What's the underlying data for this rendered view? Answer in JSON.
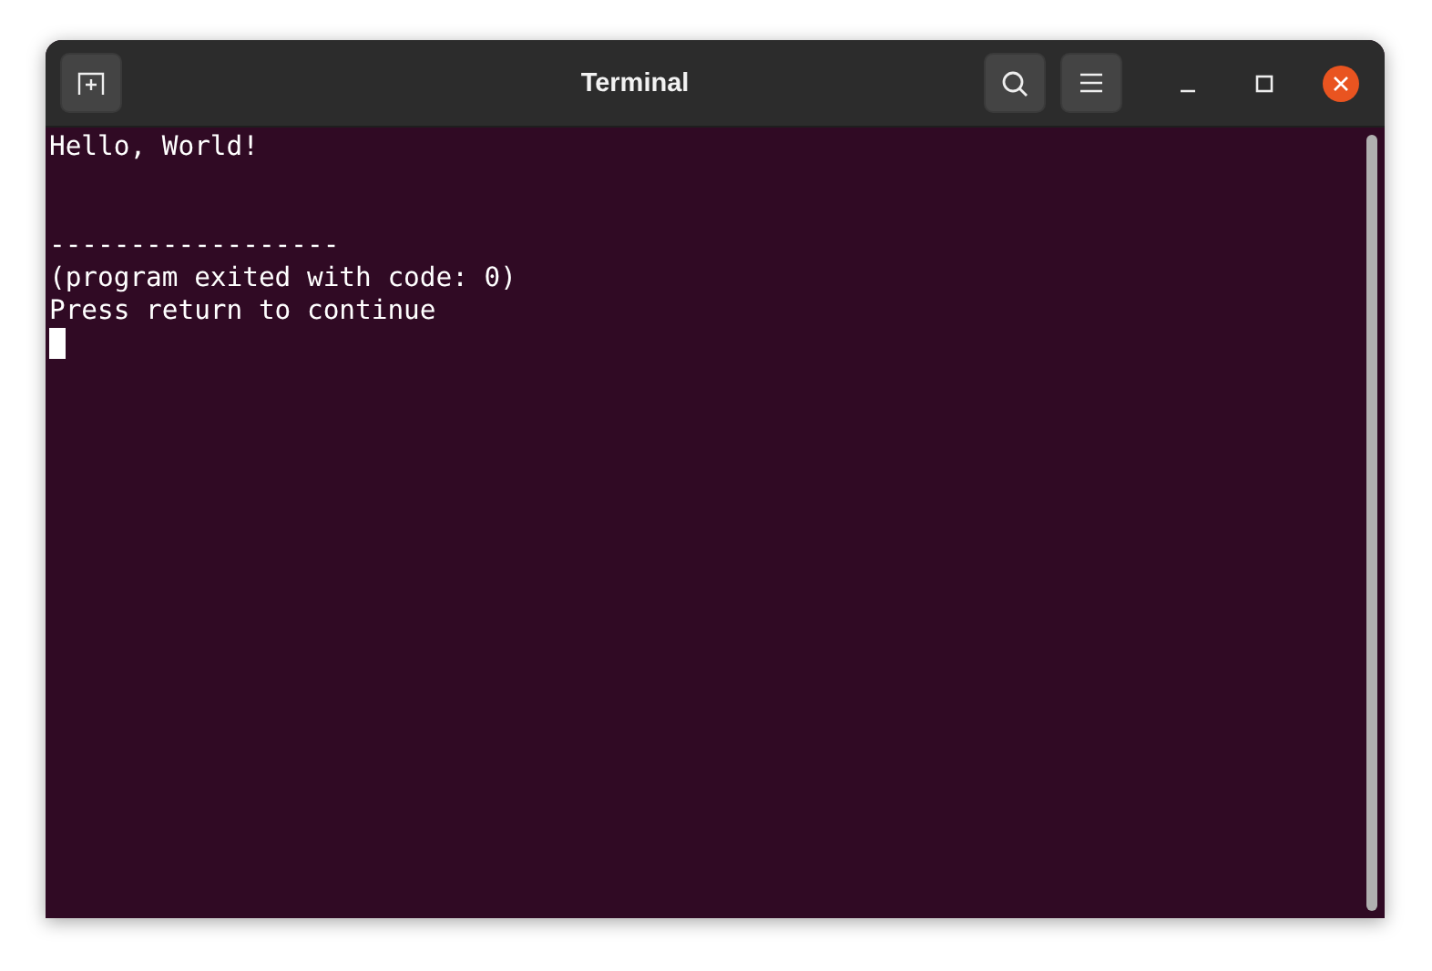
{
  "window": {
    "title": "Terminal"
  },
  "terminal": {
    "lines": [
      {
        "kind": "text",
        "text": "Hello, World!"
      },
      {
        "kind": "blank"
      },
      {
        "kind": "blank"
      },
      {
        "kind": "text",
        "text": "------------------"
      },
      {
        "kind": "text",
        "text": "(program exited with code: 0)"
      },
      {
        "kind": "text",
        "text": "Press return to continue"
      },
      {
        "kind": "cursor"
      }
    ]
  }
}
